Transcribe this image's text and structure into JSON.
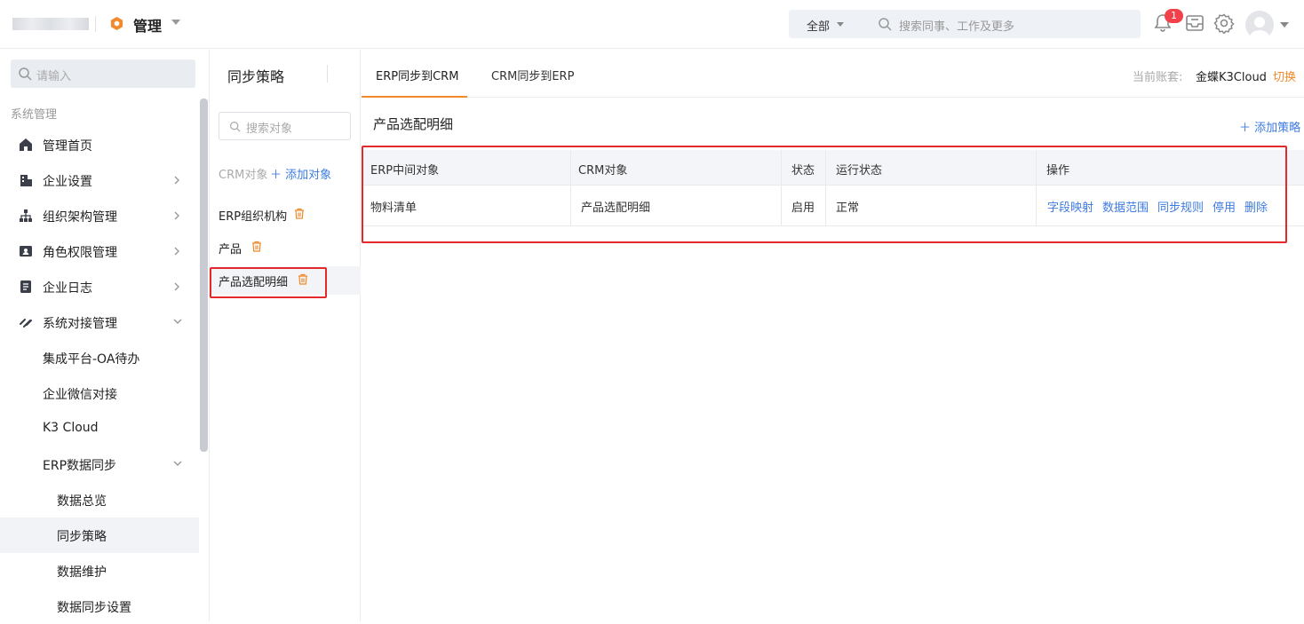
{
  "topbar": {
    "app_title": "管理",
    "search_scope": "全部",
    "search_placeholder": "搜索同事、工作及更多",
    "notification_count": "1"
  },
  "sidebar": {
    "search_placeholder": "请输入",
    "section_label": "系统管理",
    "items": [
      {
        "label": "管理首页",
        "icon": "home-icon"
      },
      {
        "label": "企业设置",
        "icon": "building-icon"
      },
      {
        "label": "组织架构管理",
        "icon": "org-chart-icon"
      },
      {
        "label": "角色权限管理",
        "icon": "id-card-icon"
      },
      {
        "label": "企业日志",
        "icon": "log-icon"
      },
      {
        "label": "系统对接管理",
        "icon": "link-icon"
      },
      {
        "label": "集成平台-OA待办"
      },
      {
        "label": "企业微信对接"
      },
      {
        "label": "K3 Cloud"
      },
      {
        "label": "ERP数据同步"
      },
      {
        "label": "数据总览"
      },
      {
        "label": "同步策略"
      },
      {
        "label": "数据维护"
      },
      {
        "label": "数据同步设置"
      }
    ]
  },
  "mid": {
    "title": "同步策略",
    "search_placeholder": "搜索对象",
    "crm_label": "CRM对象",
    "add_object": "添加对象",
    "objects": [
      {
        "label": "ERP组织机构"
      },
      {
        "label": "产品"
      },
      {
        "label": "产品选配明细"
      }
    ]
  },
  "tabs": [
    {
      "label": "ERP同步到CRM"
    },
    {
      "label": "CRM同步到ERP"
    }
  ],
  "account": {
    "label": "当前账套:",
    "name": "金蝶K3Cloud",
    "switch": "切换"
  },
  "main": {
    "section_title": "产品选配明细",
    "add_policy": "添加策略",
    "columns": [
      "ERP中间对象",
      "CRM对象",
      "状态",
      "运行状态",
      "操作"
    ],
    "rows": [
      {
        "erp_object": "物料清单",
        "crm_object": "产品选配明细",
        "status": "启用",
        "run_status": "正常",
        "actions": [
          "字段映射",
          "数据范围",
          "同步规则",
          "停用",
          "删除"
        ]
      }
    ]
  },
  "colors": {
    "accent_orange": "#f08a2b",
    "link_blue": "#3e7be0",
    "highlight_red": "#e4292b",
    "badge_red": "#f2414b"
  }
}
